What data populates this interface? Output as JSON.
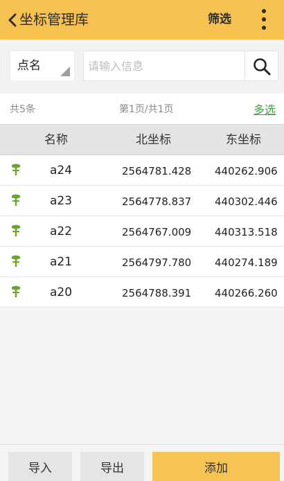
{
  "header": {
    "title": "坐标管理库",
    "filter_label": "筛选",
    "back_icon": "chevron-left-icon",
    "more_icon": "more-vertical-icon"
  },
  "search": {
    "field_selected": "点名",
    "placeholder": "请输入信息",
    "value": "",
    "search_icon": "search-icon"
  },
  "info": {
    "total": "共5条",
    "page": "第1页/共1页",
    "multi_select_label": "多选"
  },
  "table": {
    "columns": [
      "名称",
      "北坐标",
      "东坐标"
    ],
    "rows": [
      {
        "name": "a24",
        "north": "2564781.428",
        "east": "440262.906"
      },
      {
        "name": "a23",
        "north": "2564778.837",
        "east": "440302.446"
      },
      {
        "name": "a22",
        "north": "2564767.009",
        "east": "440313.518"
      },
      {
        "name": "a21",
        "north": "2564797.780",
        "east": "440274.189"
      },
      {
        "name": "a20",
        "north": "2564788.391",
        "east": "440266.260"
      }
    ],
    "row_icon": "pin-icon"
  },
  "footer": {
    "import_label": "导入",
    "export_label": "导出",
    "add_label": "添加"
  },
  "colors": {
    "header_bg": "#f5c14f",
    "accent_green": "#3aa33f",
    "pin_green": "#6aa62a",
    "add_button_bg": "#f6c455"
  }
}
